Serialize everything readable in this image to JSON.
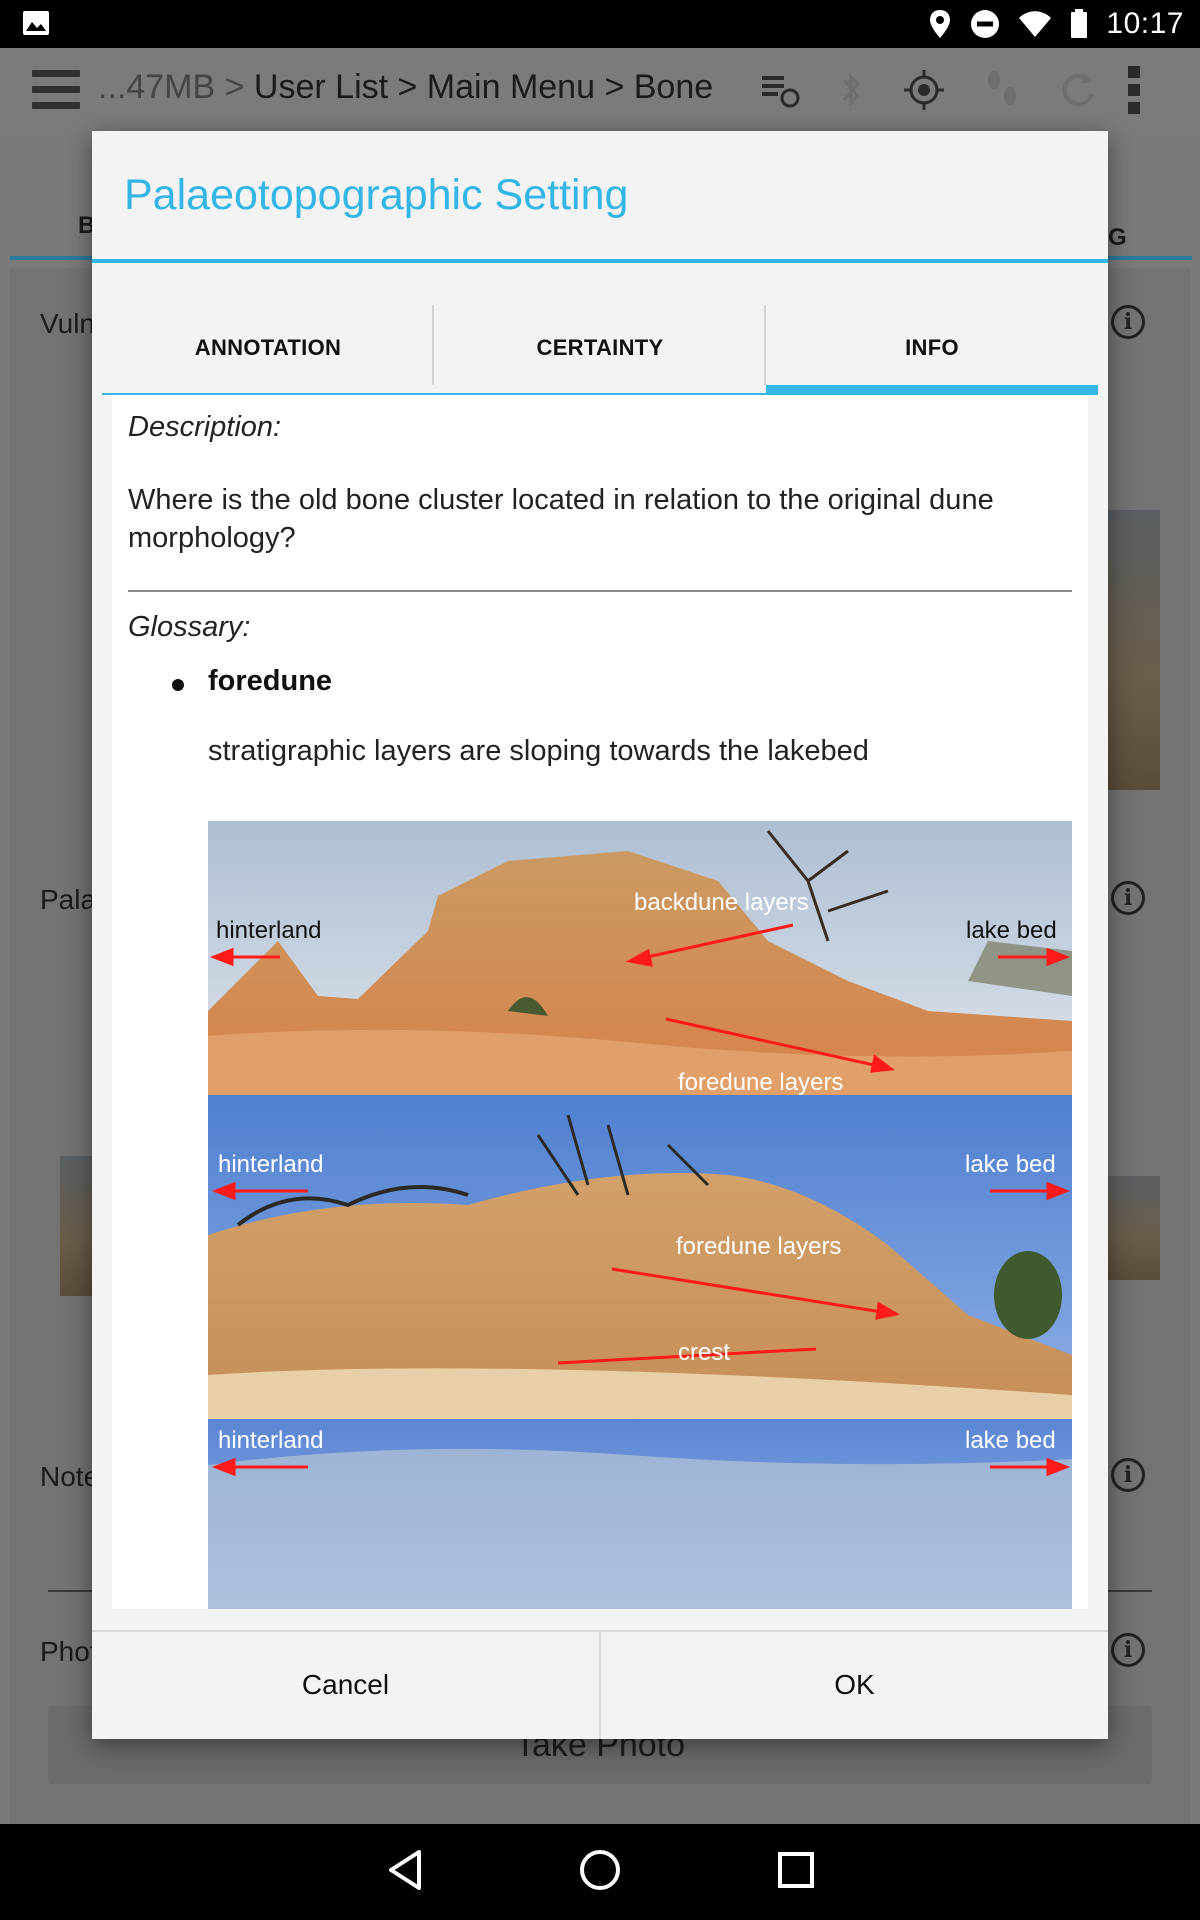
{
  "status_bar": {
    "time": "10:17",
    "icons": [
      "image-notification-icon",
      "location-icon",
      "do-not-disturb-icon",
      "wifi-icon",
      "battery-icon"
    ]
  },
  "app": {
    "breadcrumb_prefix": "...47MB >",
    "breadcrumb": "User List > Main Menu > Bone",
    "tab_left_letter": "B",
    "tab_right_letter": "G",
    "field_labels": {
      "vulnerability": "Vulne",
      "palaeo": "Pala",
      "notes": "Note",
      "photo": "Phot"
    },
    "take_photo_label": "Take Photo"
  },
  "dialog": {
    "title": "Palaeotopographic Setting",
    "tabs": [
      {
        "label": "ANNOTATION",
        "active": false
      },
      {
        "label": "CERTAINTY",
        "active": false
      },
      {
        "label": "INFO",
        "active": true
      }
    ],
    "description_label": "Description:",
    "description_text": "Where is the old bone cluster located in relation to the original dune morphology?",
    "glossary_label": "Glossary:",
    "glossary": [
      {
        "term": "foredune",
        "definition": "stratigraphic layers are sloping towards the lakebed"
      }
    ],
    "photos": [
      {
        "labels": {
          "left": "hinterland",
          "right": "lake bed",
          "upper": "backdune layers",
          "lower": "foredune layers"
        }
      },
      {
        "labels": {
          "left": "hinterland",
          "right": "lake bed",
          "upper": "foredune layers",
          "lower": "crest"
        }
      },
      {
        "labels": {
          "left": "hinterland",
          "right": "lake bed"
        }
      }
    ],
    "cancel_label": "Cancel",
    "ok_label": "OK"
  },
  "colors": {
    "accent": "#33b5e5",
    "arrow_red": "#ff1a1a"
  }
}
